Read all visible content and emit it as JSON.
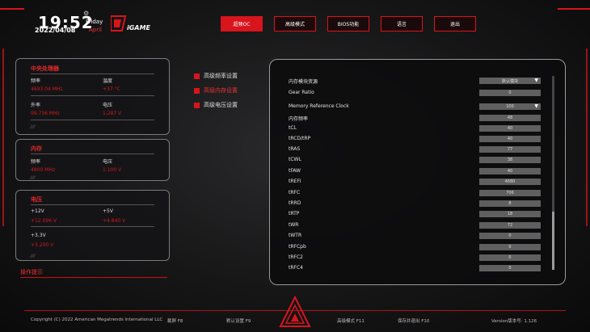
{
  "clock": {
    "time": "19:52",
    "date": "2022/04/08",
    "day": "Friday",
    "month": "April"
  },
  "brand": {
    "logo_text": "iGAME"
  },
  "tabs": [
    {
      "label": "超频OC",
      "active": true
    },
    {
      "label": "高级模式",
      "active": false
    },
    {
      "label": "BIOS功能",
      "active": false
    },
    {
      "label": "语言",
      "active": false
    },
    {
      "label": "退出",
      "active": false
    }
  ],
  "cpu": {
    "title": "中央处理器",
    "freq_label": "频率",
    "freq_value": "4693.04 MHz",
    "temp_label": "温度",
    "temp_value": "+37 °C",
    "bclk_label": "外率",
    "bclk_value": "99.756 MHz",
    "volt_label": "电压",
    "volt_value": "1.287 V"
  },
  "memory": {
    "title": "内存",
    "freq_label": "频率",
    "freq_value": "4800 MHz",
    "volt_label": "电压",
    "volt_value": "1.100 V"
  },
  "power": {
    "title": "电压",
    "v12_label": "+12V",
    "v12_value": "+12.096 V",
    "v5_label": "+5V",
    "v5_value": "+4.840 V",
    "v33_label": "+3.3V",
    "v33_value": "+3.200 V"
  },
  "menu": [
    {
      "label": "高级频率设置",
      "active": false
    },
    {
      "label": "高级内存设置",
      "active": true
    },
    {
      "label": "高级电压设置",
      "active": false
    }
  ],
  "hint_label": "操作提示",
  "settings": [
    {
      "label": "内存模块资源",
      "value": "默认模块",
      "dropdown": true
    },
    {
      "label": "Gear Ratio",
      "value": "0",
      "dropdown": false
    },
    {
      "label": "Memory Reference Clock",
      "value": "100",
      "dropdown": true
    },
    {
      "label": "内存频率",
      "value": "48",
      "dropdown": false
    },
    {
      "label": "tCL",
      "value": "40",
      "dropdown": false
    },
    {
      "label": "tRCD/tRP",
      "value": "40",
      "dropdown": false
    },
    {
      "label": "tRAS",
      "value": "77",
      "dropdown": false
    },
    {
      "label": "tCWL",
      "value": "38",
      "dropdown": false
    },
    {
      "label": "tFAW",
      "value": "40",
      "dropdown": false
    },
    {
      "label": "tREFI",
      "value": "4680",
      "dropdown": false
    },
    {
      "label": "tRFC",
      "value": "706",
      "dropdown": false
    },
    {
      "label": "tRRD",
      "value": "8",
      "dropdown": false
    },
    {
      "label": "tRTP",
      "value": "18",
      "dropdown": false
    },
    {
      "label": "tWR",
      "value": "72",
      "dropdown": false
    },
    {
      "label": "tWTR",
      "value": "0",
      "dropdown": false
    },
    {
      "label": "tRFCpb",
      "value": "0",
      "dropdown": false
    },
    {
      "label": "tRFC2",
      "value": "0",
      "dropdown": false
    },
    {
      "label": "tRFC4",
      "value": "0",
      "dropdown": false
    }
  ],
  "footer": {
    "copyright": "Copyright (C) 2022 American Megatrends International LLC",
    "screenshot": "截屏 F8",
    "defaults": "默认设置 F9",
    "advanced": "高级模式 F11",
    "save_exit": "保存并退出 F10",
    "version": "Version版本号: 1.126"
  },
  "colors": {
    "accent": "#d8141c",
    "panel_border": "#7a7a7a",
    "field_bg": "#5f5f5f"
  }
}
